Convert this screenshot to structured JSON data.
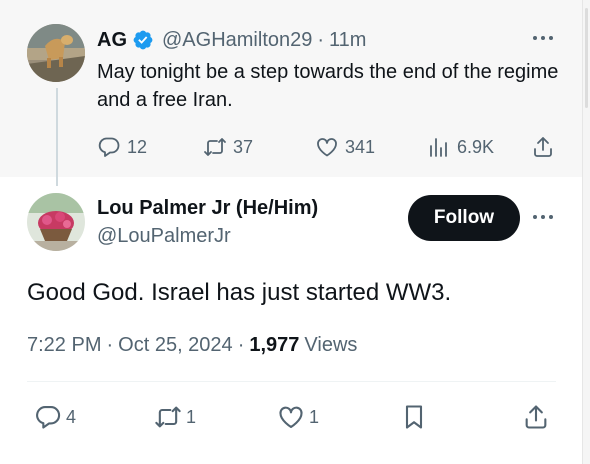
{
  "parent_tweet": {
    "name": "AG",
    "handle": "@AGHamilton29",
    "separator": "·",
    "time": "11m",
    "text": "May tonight be a step towards the end of the regime and a free Iran.",
    "replies": "12",
    "retweets": "37",
    "likes": "341",
    "views": "6.9K"
  },
  "main_tweet": {
    "name": "Lou Palmer Jr (He/Him)",
    "handle": "@LouPalmerJr",
    "follow_label": "Follow",
    "text": "Good God. Israel has just started WW3.",
    "time": "7:22 PM",
    "separator": "·",
    "date": "Oct 25, 2024",
    "views_count": "1,977",
    "views_label": "Views",
    "replies": "4",
    "retweets": "1",
    "likes": "1"
  },
  "colors": {
    "verified_blue": "#1d9bf0",
    "text_primary": "#0f1419",
    "text_secondary": "#536471",
    "follow_button_bg": "#0f1419"
  },
  "icons": [
    "verified-badge-icon",
    "more-icon",
    "reply-icon",
    "retweet-icon",
    "like-icon",
    "views-icon",
    "share-icon",
    "bookmark-icon"
  ]
}
